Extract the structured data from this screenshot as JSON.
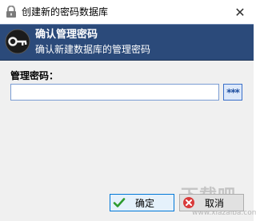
{
  "window": {
    "title": "创建新的密码数据库",
    "close_glyph": "✕"
  },
  "banner": {
    "title": "确认管理密码",
    "subtitle": "确认新建数据库的管理密码",
    "background": "#2b4a7a",
    "icon": "key-icon"
  },
  "form": {
    "field_label": "管理密码：",
    "password_value": "",
    "reveal_label": "***"
  },
  "buttons": {
    "ok_label": "确定",
    "cancel_label": "取消"
  },
  "watermark": {
    "text": "下载吧",
    "url": "www.xiazaiba.com"
  }
}
